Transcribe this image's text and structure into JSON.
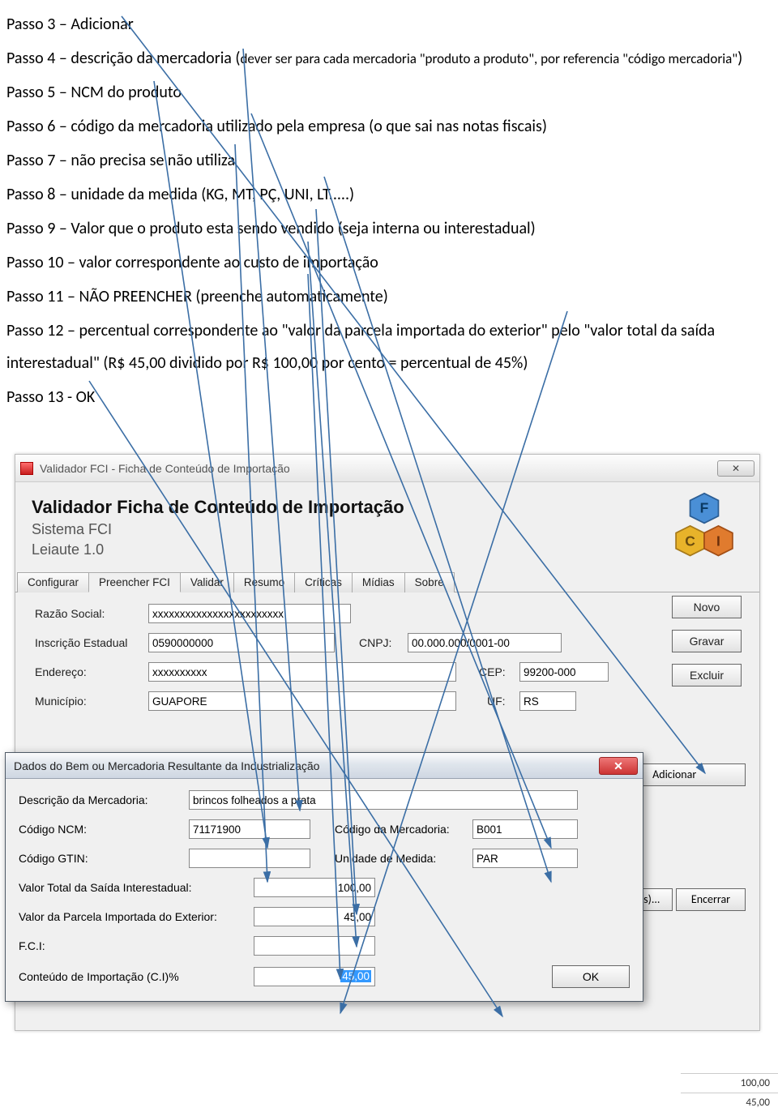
{
  "doc": {
    "p3": "Passo 3 – Adicionar",
    "p4a": "Passo 4 – descrição da mercadoria (",
    "p4b": "dever ser para cada mercadoria \"produto a produto\", por referencia \"código mercadoria\"",
    "p4c": ")",
    "p5": "Passo 5 – NCM do produto",
    "p6": "Passo 6 – código da mercadoria utilizado pela empresa (o que sai nas notas fiscais)",
    "p7": "Passo 7 – não precisa se não utiliza",
    "p8": "Passo 8 – unidade da medida (KG, MT, PÇ, UNI, LT.....)",
    "p9": "Passo 9 – Valor que o produto esta sendo vendido  (seja interna ou interestadual)",
    "p10": "Passo 10 – valor correspondente ao custo de importação",
    "p11": "Passo 11 – NÃO PREENCHER (preenche automaticamente)",
    "p12": "Passo 12 – percentual correspondente ao \"valor da parcela importada do exterior\" pelo  \"valor total da saída interestadual\" (R$ 45,00 dividido por R$ 100,00 por cento = percentual de 45%)",
    "p13": "Passo 13 - OK"
  },
  "app": {
    "windowTitle": "Validador FCI - Ficha de Conteúdo de Importação",
    "closeGlyph": "✕",
    "header": {
      "title": "Validador Ficha de Conteúdo de Importação",
      "sub1": "Sistema FCI",
      "sub2": "Leiaute 1.0"
    },
    "tabs": {
      "t0": "Configurar",
      "t1": "Preencher FCI",
      "t2": "Validar",
      "t3": "Resumo",
      "t4": "Críticas",
      "t5": "Mídias",
      "t6": "Sobre"
    },
    "form": {
      "razaoLabel": "Razão Social:",
      "razaoValue": "xxxxxxxxxxxxxxxxxxxxxxxx",
      "ieLabel": "Inscrição Estadual",
      "ieValue": "0590000000",
      "cnpjLabel": "CNPJ:",
      "cnpjValue": "00.000.000/0001-00",
      "endLabel": "Endereço:",
      "endValue": "xxxxxxxxxx",
      "cepLabel": "CEP:",
      "cepValue": "99200-000",
      "munLabel": "Município:",
      "munValue": "GUAPORE",
      "ufLabel": "UF:",
      "ufValue": "RS"
    },
    "buttons": {
      "novo": "Novo",
      "gravar": "Gravar",
      "excluir": "Excluir",
      "adicionar": "Adicionar",
      "fichas": "Ficha(s)...",
      "encerrar": "Encerrar"
    },
    "bgRows": {
      "r1": "100,00",
      "r2": "45,00"
    }
  },
  "dialog": {
    "title": "Dados do Bem ou Mercadoria Resultante da Industrialização",
    "closeGlyph": "✕",
    "descLabel": "Descrição da Mercadoria:",
    "descValue": "brincos folheados a prata",
    "ncmLabel": "Código NCM:",
    "ncmValue": "71171900",
    "codMercLabel": "Código da Mercadoria:",
    "codMercValue": "B001",
    "gtinLabel": "Código GTIN:",
    "gtinValue": "",
    "unLabel": "Unidade de Medida:",
    "unValue": "PAR",
    "vtotLabel": "Valor Total da Saída Interestadual:",
    "vtotValue": "100,00",
    "vparLabel": "Valor da Parcela Importada do Exterior:",
    "vparValue": "45,00",
    "fciLabel": "F.C.I:",
    "fciValue": "",
    "ciLabel": "Conteúdo de Importação (C.I)%",
    "ciValue": "45,00",
    "ok": "OK"
  }
}
